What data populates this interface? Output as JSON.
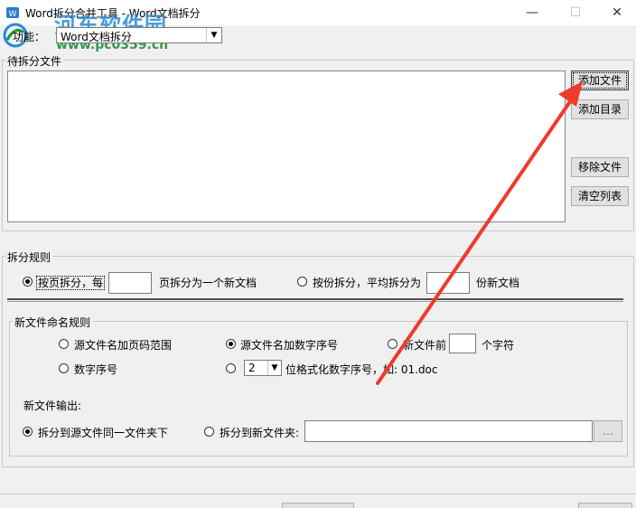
{
  "window": {
    "title": "Word拆分合并工具 - Word文档拆分",
    "minimize": "—",
    "maximize": "☐",
    "close": "✕"
  },
  "watermark": {
    "site_name": "河东软件园",
    "site_url": "www.pc0359.cn"
  },
  "function": {
    "label": "功能：",
    "selected": "Word文档拆分"
  },
  "files": {
    "group_label": "待拆分文件",
    "add_file": "添加文件",
    "add_folder": "添加目录",
    "remove_file": "移除文件",
    "clear_list": "清空列表"
  },
  "split_rule": {
    "group_label": "拆分规则",
    "by_page_label": "按页拆分，每",
    "by_page_suffix": "页拆分为一个新文档",
    "by_page_value": "",
    "by_part_label": "按份拆分，平均拆分为",
    "by_part_suffix": "份新文档",
    "by_part_value": "",
    "selected": "by_page"
  },
  "naming": {
    "group_label": "新文件命名规则",
    "opt_page_range": "源文件名加页码范围",
    "opt_src_seq": "源文件名加数字序号",
    "opt_prefix_label": "新文件前",
    "opt_prefix_suffix": "个字符",
    "opt_prefix_value": "",
    "opt_seq": "数字序号",
    "opt_format_value": "2",
    "opt_format_label": "位格式化数字序号，如: 01.doc",
    "selected": "src_seq"
  },
  "output": {
    "label": "新文件输出:",
    "same_folder": "拆分到源文件同一文件夹下",
    "new_folder": "拆分到新文件夹:",
    "folder_value": "",
    "browse": "...",
    "selected": "same_folder"
  },
  "colors": {
    "arrow": "#f03a2a",
    "watermark_blue": "#2a8bd6",
    "watermark_green": "#1e8f3c"
  }
}
